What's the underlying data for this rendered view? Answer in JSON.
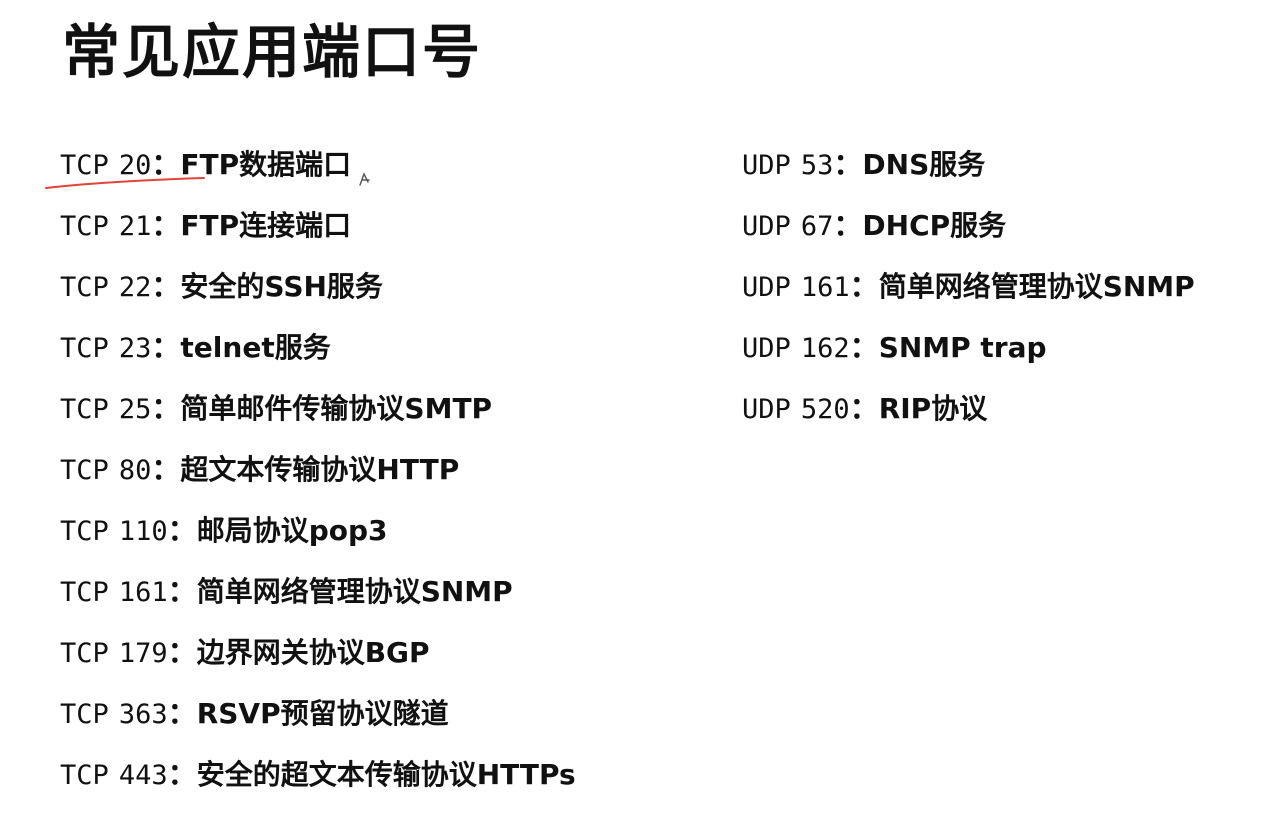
{
  "title": "常见应用端口号",
  "tcp_ports": [
    {
      "protocol": "TCP",
      "port": "20",
      "sep": "：",
      "description": "FTP数据端口"
    },
    {
      "protocol": "TCP",
      "port": "21",
      "sep": "：",
      "description": "FTP连接端口"
    },
    {
      "protocol": "TCP",
      "port": "22",
      "sep": "：",
      "description": "安全的SSH服务"
    },
    {
      "protocol": "TCP",
      "port": "23",
      "sep": "：",
      "description": "telnet服务"
    },
    {
      "protocol": "TCP",
      "port": "25",
      "sep": "：",
      "description": "简单邮件传输协议SMTP"
    },
    {
      "protocol": "TCP",
      "port": "80",
      "sep": "：",
      "description": "超文本传输协议HTTP"
    },
    {
      "protocol": "TCP",
      "port": "110",
      "sep": "：",
      "description": "邮局协议pop3"
    },
    {
      "protocol": "TCP",
      "port": "161",
      "sep": "：",
      "description": "简单网络管理协议SNMP"
    },
    {
      "protocol": "TCP",
      "port": "179",
      "sep": "：",
      "description": "边界网关协议BGP"
    },
    {
      "protocol": "TCP",
      "port": "363",
      "sep": "：",
      "description": "RSVP预留协议隧道"
    },
    {
      "protocol": "TCP",
      "port": "443",
      "sep": "：",
      "description": "安全的超文本传输协议HTTPs"
    }
  ],
  "udp_ports": [
    {
      "protocol": "UDP",
      "port": "53",
      "sep": "：",
      "description": "DNS服务"
    },
    {
      "protocol": "UDP",
      "port": "67",
      "sep": "：",
      "description": "DHCP服务"
    },
    {
      "protocol": "UDP",
      "port": "161",
      "sep": "：",
      "description": "简单网络管理协议SNMP"
    },
    {
      "protocol": "UDP",
      "port": "162",
      "sep": "：",
      "description": "SNMP trap"
    },
    {
      "protocol": "UDP",
      "port": "520",
      "sep": "：",
      "description": "RIP协议"
    }
  ],
  "colors": {
    "text": "#111111",
    "annotation_underline": "#e0443a",
    "background": "#ffffff"
  }
}
